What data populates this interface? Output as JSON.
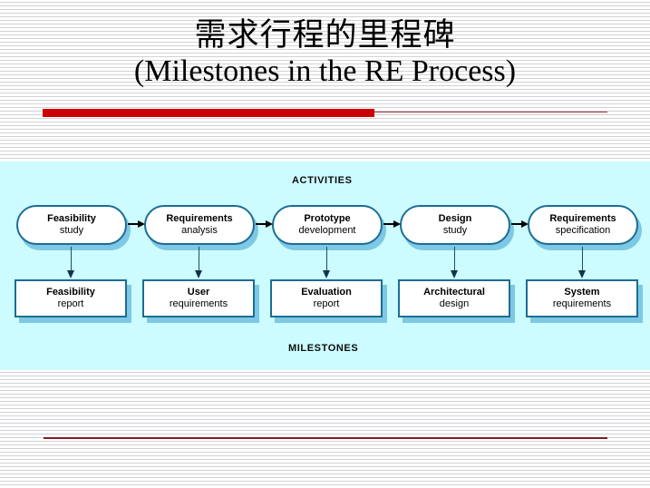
{
  "slide": {
    "title_cjk": "需求行程的里程碑",
    "title_latin": "(Milestones in the RE Process)",
    "accent_red": "#cc0000",
    "rule_red": "#9c2c2c",
    "bottom_rule_color": "#7b1d28",
    "panel_background": "#ccfcff",
    "node_border_color": "#1b6d96",
    "node_shadow_color": "#7ec8e3",
    "node_fill": "#ffffff"
  },
  "diagram": {
    "caption_activities": "ACTIVITIES",
    "caption_milestones": "MILESTONES",
    "activities": [
      {
        "line1": "Feasibility",
        "line2": "study"
      },
      {
        "line1": "Requirements",
        "line2": "analysis"
      },
      {
        "line1": "Prototype",
        "line2": "development"
      },
      {
        "line1": "Design",
        "line2": "study"
      },
      {
        "line1": "Requirements",
        "line2": "specification"
      }
    ],
    "milestones": [
      {
        "line1": "Feasibility",
        "line2": "report"
      },
      {
        "line1": "User",
        "line2": "requirements"
      },
      {
        "line1": "Evaluation",
        "line2": "report"
      },
      {
        "line1": "Architectural",
        "line2": "design"
      },
      {
        "line1": "System",
        "line2": "requirements"
      }
    ]
  }
}
